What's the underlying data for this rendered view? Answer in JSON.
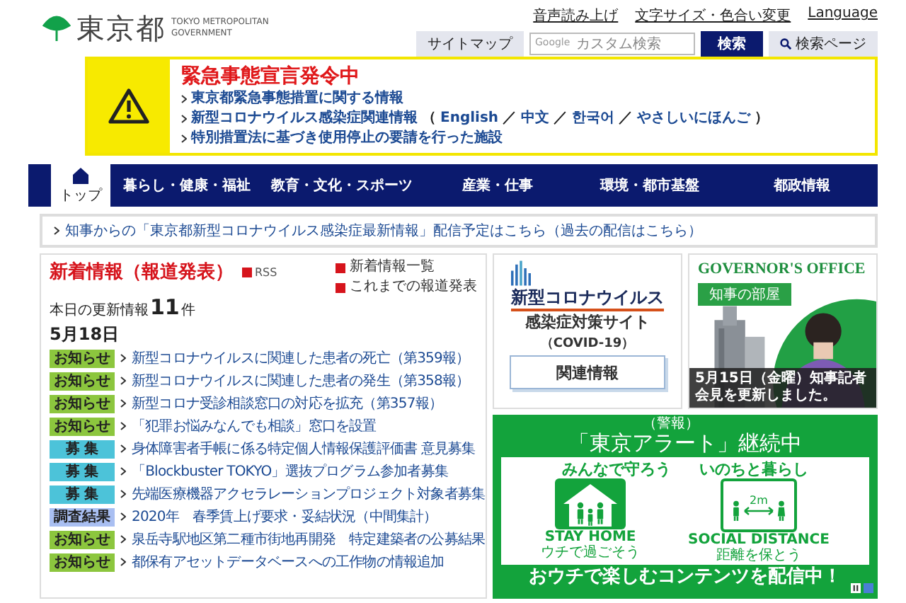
{
  "header": {
    "logo": {
      "name": "東京都",
      "subtitle": [
        "TOKYO METROPOLITAN",
        "GOVERNMENT"
      ]
    },
    "utility_links": [
      "音声読み上げ",
      "文字サイズ・色合い変更",
      "Language"
    ],
    "sitemap_button": "サイトマップ",
    "search": {
      "brand": "Google",
      "placeholder": "カスタム検索"
    },
    "search_button": "検索",
    "search_page_button": "検索ページ"
  },
  "emergency": {
    "title": "緊急事態宣言発令中",
    "links": [
      {
        "text": "東京都緊急事態措置に関する情報"
      },
      {
        "text": "新型コロナウイルス感染症関連情報",
        "open": "（",
        "languages": [
          "English",
          "中文",
          "한국어",
          "やさしいにほんご"
        ],
        "separator": "／",
        "close": "）"
      },
      {
        "text": "特別措置法に基づき使用停止の要請を行った施設"
      }
    ]
  },
  "nav": {
    "tabs": [
      {
        "kind": "home",
        "label": "トップ",
        "selected": true
      },
      {
        "kind": "text",
        "label": "暮らし・健康・福祉",
        "selected": false
      },
      {
        "kind": "text",
        "label": "教育・文化・スポーツ",
        "selected": false
      },
      {
        "kind": "text",
        "label": "産業・仕事",
        "selected": false
      },
      {
        "kind": "text",
        "label": "環境・都市基盤",
        "selected": false
      },
      {
        "kind": "text",
        "label": "都政情報",
        "selected": false
      }
    ]
  },
  "notice": "知事からの「東京都新型コロナウイルス感染症最新情報」配信予定はこちら（過去の配信はこちら）",
  "news": {
    "title": "新着情報（報道発表）",
    "rss": "RSS",
    "side_links": [
      "新着情報一覧",
      "これまでの報道発表"
    ],
    "count_label": "本日の更新情報",
    "count": "11",
    "count_unit": "件",
    "date": "5月18日",
    "items": [
      {
        "tag": "お知らせ",
        "color": "#8cc63e",
        "text": "新型コロナウイルスに関連した患者の死亡（第359報）"
      },
      {
        "tag": "お知らせ",
        "color": "#8cc63e",
        "text": "新型コロナウイルスに関連した患者の発生（第358報）"
      },
      {
        "tag": "お知らせ",
        "color": "#8cc63e",
        "text": "新型コロナ受診相談窓口の対応を拡充（第357報）"
      },
      {
        "tag": "お知らせ",
        "color": "#8cc63e",
        "text": "「犯罪お悩みなんでも相談」窓口を設置"
      },
      {
        "tag": "募 集",
        "color": "#4cc3d9",
        "text": "身体障害者手帳に係る特定個人情報保護評価書 意見募集"
      },
      {
        "tag": "募 集",
        "color": "#4cc3d9",
        "text": "「Blockbuster TOKYO」選抜プログラム参加者募集"
      },
      {
        "tag": "募 集",
        "color": "#4cc3d9",
        "text": "先端医療機器アクセラレーションプロジェクト対象者募集"
      },
      {
        "tag": "調査結果",
        "color": "#a9bff2",
        "text": "2020年　春季賃上げ要求・妥結状況（中間集計）"
      },
      {
        "tag": "お知らせ",
        "color": "#8cc63e",
        "text": "泉岳寺駅地区第二種市街地再開発　特定建築者の公募結果"
      },
      {
        "tag": "お知らせ",
        "color": "#8cc63e",
        "text": "都保有アセットデータベースへの工作物の情報追加"
      }
    ]
  },
  "covid_card": {
    "title": "新型コロナウイルス",
    "subtitle": "感染症対策サイト",
    "note": "（COVID-19）",
    "button": "関連情報"
  },
  "governor": {
    "heading": "GOVERNOR'S OFFICE",
    "badge": "知事の部屋",
    "caption": "5月15日（金曜）知事記者会見を更新しました。"
  },
  "alert": {
    "ruby": "（警報）",
    "title": "「東京アラート」継続中",
    "phrases": [
      "みんなで守ろう",
      "いのちと暮らし"
    ],
    "stay_home": {
      "label": "STAY HOME",
      "sub": "ウチで過ごそう"
    },
    "distance": {
      "measure": "2m",
      "label": "SOCIAL DISTANCE",
      "sub": "距離を保とう"
    },
    "footer": "おウチで楽しむコンテンツを配信中！"
  }
}
